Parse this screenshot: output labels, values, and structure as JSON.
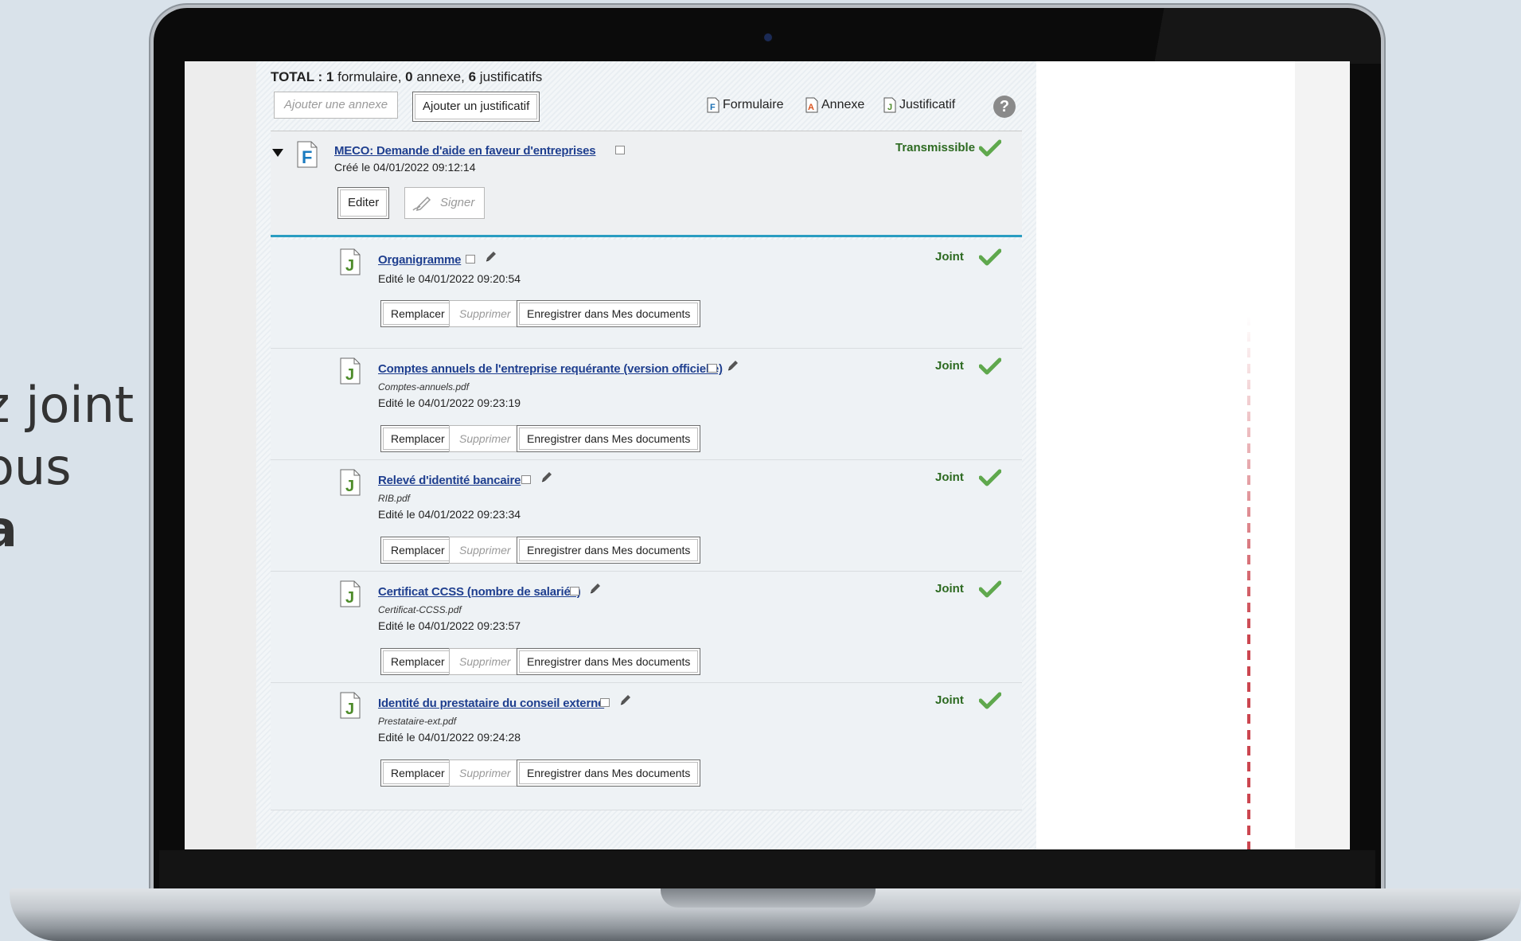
{
  "side_text": {
    "line1": "z joint",
    "line2": "ous",
    "line3": "a"
  },
  "summary": {
    "total_label": "TOTAL :",
    "forms_count": "1",
    "forms_label": "formulaire,",
    "annexes_count": "0",
    "annexes_label": "annexe,",
    "justif_count": "6",
    "justif_label": "justificatifs"
  },
  "toolbar": {
    "add_annex": "Ajouter une annexe",
    "add_justif": "Ajouter un justificatif",
    "legend_form": "Formulaire",
    "legend_annex": "Annexe",
    "legend_justif": "Justificatif",
    "help": "?"
  },
  "form": {
    "title": "MECO: Demande d'aide en faveur d'entreprises",
    "created": "Créé le 04/01/2022 09:12:14",
    "status": "Transmissible",
    "edit_button": "Editer",
    "sign_button": "Signer"
  },
  "attachments": [
    {
      "title": "Organigramme",
      "file": "",
      "edited": "Edité le 04/01/2022 09:20:54",
      "status": "Joint"
    },
    {
      "title": "Comptes annuels de l'entreprise requérante (version officielle)",
      "file": "Comptes-annuels.pdf",
      "edited": "Edité le 04/01/2022 09:23:19",
      "status": "Joint"
    },
    {
      "title": "Relevé d'identité bancaire",
      "file": "RIB.pdf",
      "edited": "Edité le 04/01/2022 09:23:34",
      "status": "Joint"
    },
    {
      "title": "Certificat CCSS (nombre de salariés)",
      "file": "Certificat-CCSS.pdf",
      "edited": "Edité le 04/01/2022 09:23:57",
      "status": "Joint"
    },
    {
      "title": "Identité du prestataire du conseil externe",
      "file": "Prestataire-ext.pdf",
      "edited": "Edité le 04/01/2022 09:24:28",
      "status": "Joint"
    }
  ],
  "attachment_buttons": {
    "replace": "Remplacer",
    "delete": "Supprimer",
    "save": "Enregistrer dans Mes documents"
  },
  "colors": {
    "link": "#1f3f8f",
    "status": "#2d6a21",
    "accent_line": "#2a9dc1",
    "arrow": "#c83c46"
  }
}
